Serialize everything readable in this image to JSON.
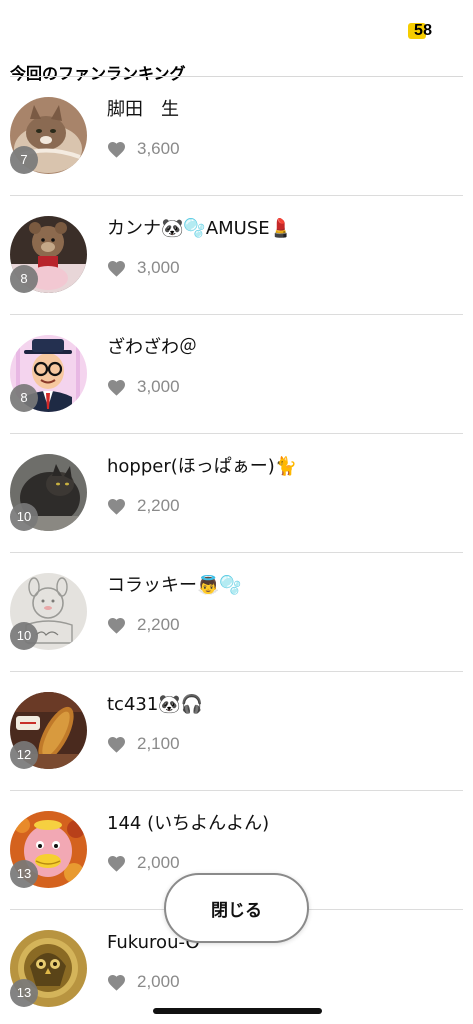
{
  "status": {
    "badge_count": "58"
  },
  "header": {
    "title": "今回のファンランキング"
  },
  "colors": {
    "badge_yellow": "#f6cd00",
    "rank_badge": "#787878",
    "like_text": "#8a8a8a"
  },
  "fans": [
    {
      "rank": "7",
      "name": "脚田　生",
      "likes": "3,600",
      "icon": "like-heart-icon",
      "avatar": "cat-avatar"
    },
    {
      "rank": "8",
      "name": "カンナ🐼🫧AMUSE💄",
      "likes": "3,000",
      "icon": "like-heart-icon",
      "avatar": "teddy-bear-avatar"
    },
    {
      "rank": "8",
      "name": "ざわざわ＠",
      "likes": "3,000",
      "icon": "like-heart-icon",
      "avatar": "cartoon-man-avatar"
    },
    {
      "rank": "10",
      "name": "hopper(ほっぱぁー)🐈",
      "likes": "2,200",
      "icon": "like-heart-icon",
      "avatar": "dark-cat-avatar"
    },
    {
      "rank": "10",
      "name": "コラッキー👼🫧",
      "likes": "2,200",
      "icon": "like-heart-icon",
      "avatar": "sketch-avatar"
    },
    {
      "rank": "12",
      "name": "tc431🐼🎧",
      "likes": "2,100",
      "icon": "like-heart-icon",
      "avatar": "food-avatar"
    },
    {
      "rank": "13",
      "name": "144 (いちよんよん)",
      "likes": "2,000",
      "icon": "like-heart-icon",
      "avatar": "pink-bird-avatar"
    },
    {
      "rank": "13",
      "name": "Fukurou-O",
      "likes": "2,000",
      "icon": "like-heart-icon",
      "avatar": "owl-emblem-avatar"
    }
  ],
  "close_button": {
    "label": "閉じる"
  }
}
